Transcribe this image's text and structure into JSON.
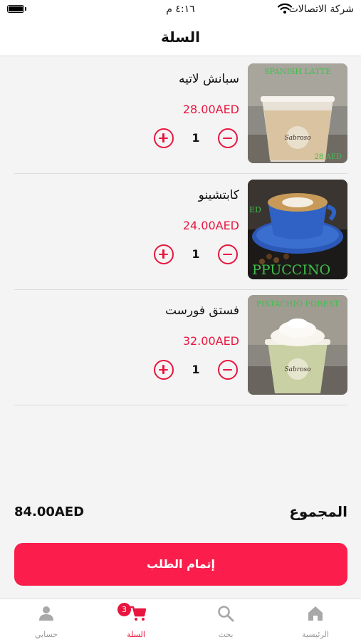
{
  "status_bar": {
    "carrier": "شركة الاتصالات",
    "time": "٤:١٦ م"
  },
  "header": {
    "title": "السلة"
  },
  "cart_items": [
    {
      "name": "سبانش لاتيه",
      "price": "28.00AED",
      "quantity": "1",
      "image_caption": "SPANISH LATTE",
      "image_price": "28 AED"
    },
    {
      "name": "كابتشينو",
      "price": "24.00AED",
      "quantity": "1",
      "image_caption": "PPUCCINO",
      "image_price": "ED"
    },
    {
      "name": "فستق فورست",
      "price": "32.00AED",
      "quantity": "1",
      "image_caption": "PISTACHIO FOREST",
      "image_price": ""
    }
  ],
  "summary": {
    "total_label": "المجموع",
    "total_value": "84.00AED"
  },
  "checkout_label": "إتمام الطلب",
  "tabs": [
    {
      "label": "الرئيسية",
      "icon": "home-icon"
    },
    {
      "label": "بحث",
      "icon": "search-icon"
    },
    {
      "label": "السلة",
      "icon": "cart-icon",
      "badge": "3",
      "active": true
    },
    {
      "label": "حسابي",
      "icon": "profile-icon"
    }
  ],
  "colors": {
    "accent": "#e8163f",
    "button": "#fb1e4c",
    "caption_green": "#3fbf4c"
  }
}
